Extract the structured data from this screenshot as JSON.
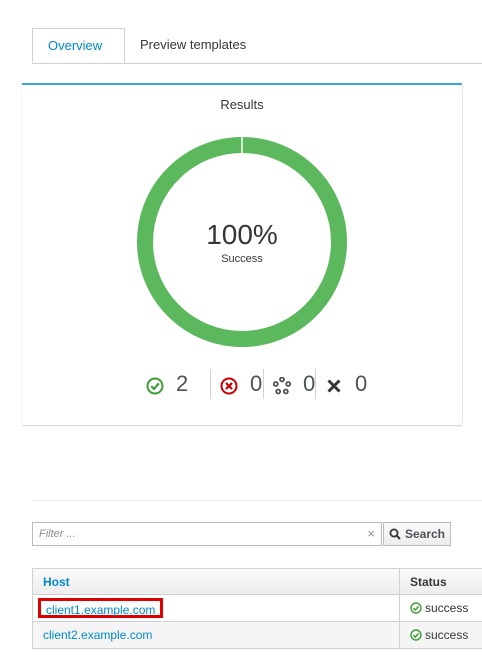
{
  "tabs": [
    {
      "label": "Overview",
      "active": true
    },
    {
      "label": "Preview templates",
      "active": false
    }
  ],
  "results": {
    "title": "Results",
    "percent": "100%",
    "percent_value": 100,
    "subtitle": "Success",
    "counts": {
      "success": "2",
      "failed": "0",
      "pending": "0",
      "cancelled": "0"
    }
  },
  "filter": {
    "placeholder": "Filter ...",
    "clear_glyph": "×",
    "search_label": "Search"
  },
  "table": {
    "columns": {
      "host": "Host",
      "status": "Status"
    },
    "rows": [
      {
        "host": "client1.example.com",
        "status": "success"
      },
      {
        "host": "client2.example.com",
        "status": "success"
      }
    ]
  },
  "colors": {
    "accent": "#0088ce",
    "success": "#5cb85c",
    "danger": "#cc0000",
    "highlight": "#e00000"
  }
}
